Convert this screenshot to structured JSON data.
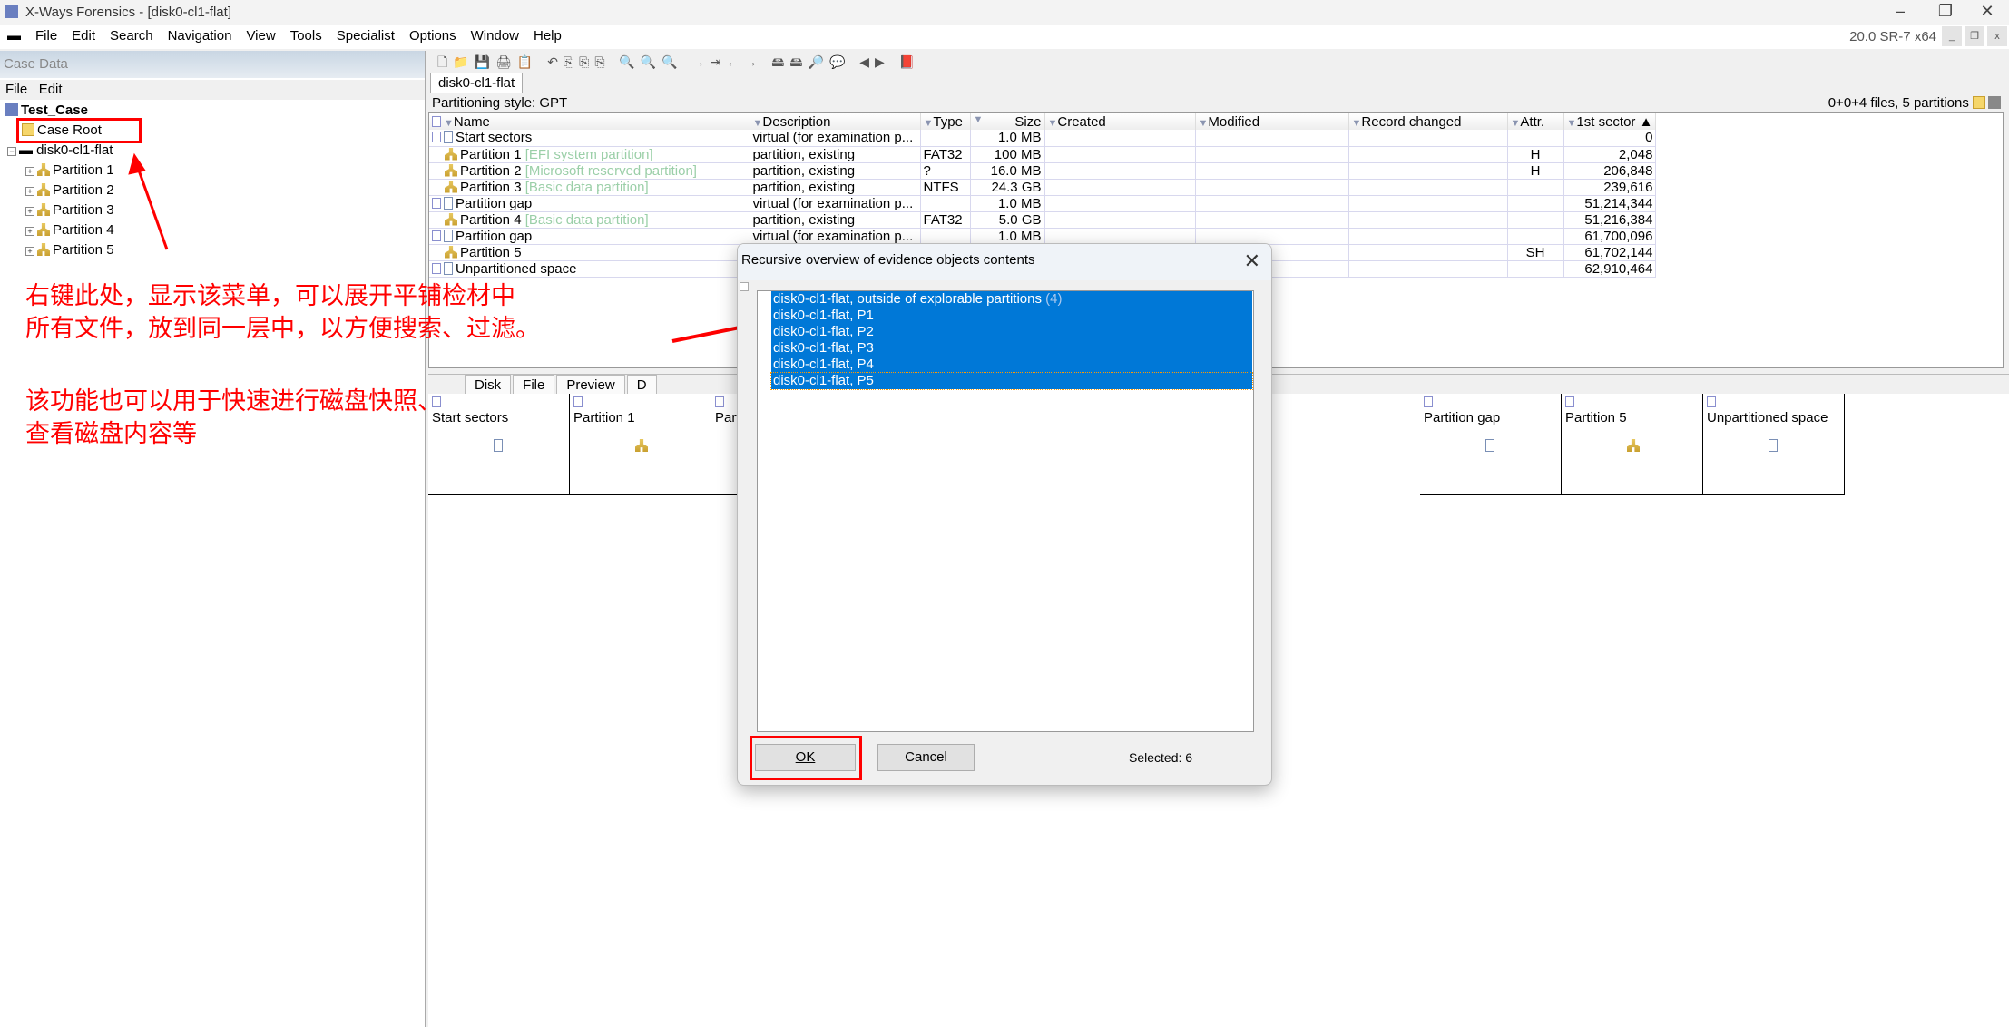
{
  "window": {
    "title": "X-Ways Forensics - [disk0-cl1-flat]",
    "version": "20.0 SR-7 x64"
  },
  "menu": [
    "File",
    "Edit",
    "Search",
    "Navigation",
    "View",
    "Tools",
    "Specialist",
    "Options",
    "Window",
    "Help"
  ],
  "case_panel": {
    "header": "Case Data",
    "menu": [
      "File",
      "Edit"
    ],
    "case_name": "Test_Case",
    "case_root": "Case Root",
    "evidence": "disk0-cl1-flat",
    "partitions": [
      "Partition 1",
      "Partition 2",
      "Partition 3",
      "Partition 4",
      "Partition 5"
    ]
  },
  "tab": "disk0-cl1-flat",
  "partitioning_style": "Partitioning style: GPT",
  "counts": "0+0+4 files, 5 partitions",
  "columns": [
    "Name",
    "Description",
    "Type",
    "Size",
    "Created",
    "Modified",
    "Record changed",
    "Attr.",
    "1st sector"
  ],
  "rows": [
    {
      "name": "Start sectors",
      "note": "",
      "desc": "virtual (for examination p...",
      "type": "",
      "size": "1.0 MB",
      "attr": "",
      "sector": "0",
      "icon": "file"
    },
    {
      "name": "Partition 1",
      "note": "[EFI system partition]",
      "desc": "partition, existing",
      "type": "FAT32",
      "size": "100 MB",
      "attr": "H",
      "sector": "2,048",
      "icon": "partition"
    },
    {
      "name": "Partition 2",
      "note": "[Microsoft reserved partition]",
      "desc": "partition, existing",
      "type": "?",
      "size": "16.0 MB",
      "attr": "H",
      "sector": "206,848",
      "icon": "partition"
    },
    {
      "name": "Partition 3",
      "note": "[Basic data partition]",
      "desc": "partition, existing",
      "type": "NTFS",
      "size": "24.3 GB",
      "attr": "",
      "sector": "239,616",
      "icon": "partition"
    },
    {
      "name": "Partition gap",
      "note": "",
      "desc": "virtual (for examination p...",
      "type": "",
      "size": "1.0 MB",
      "attr": "",
      "sector": "51,214,344",
      "icon": "file"
    },
    {
      "name": "Partition 4",
      "note": "[Basic data partition]",
      "desc": "partition, existing",
      "type": "FAT32",
      "size": "5.0 GB",
      "attr": "",
      "sector": "51,216,384",
      "icon": "partition"
    },
    {
      "name": "Partition gap",
      "note": "",
      "desc": "virtual (for examination p...",
      "type": "",
      "size": "1.0 MB",
      "attr": "",
      "sector": "61,700,096",
      "icon": "file"
    },
    {
      "name": "Partition 5",
      "note": "",
      "desc": "",
      "type": "",
      "size": "",
      "attr": "SH",
      "sector": "61,702,144",
      "icon": "partition"
    },
    {
      "name": "Unpartitioned space",
      "note": "",
      "desc": "",
      "type": "",
      "size": "",
      "attr": "",
      "sector": "62,910,464",
      "icon": "file"
    }
  ],
  "lower_tabs": [
    "Disk",
    "File",
    "Preview",
    "D"
  ],
  "gallery": [
    {
      "label": "Start sectors",
      "icon": "file"
    },
    {
      "label": "Partition 1",
      "icon": "partition"
    },
    {
      "label": "Part",
      "icon": "partition"
    },
    {
      "label": "Partition gap",
      "icon": "file"
    },
    {
      "label": "Partition 5",
      "icon": "partition"
    },
    {
      "label": "Unpartitioned space",
      "icon": "file"
    }
  ],
  "annotations": [
    "右键此处，显示该菜单，可以展开平铺检材中",
    "所有文件，放到同一层中，以方便搜索、过滤。",
    "该功能也可以用于快速进行磁盘快照、",
    "查看磁盘内容等"
  ],
  "dialog": {
    "title": "Recursive overview of evidence objects contents",
    "items": [
      {
        "label": "disk0-cl1-flat, outside of explorable partitions",
        "count": "(4)"
      },
      {
        "label": "disk0-cl1-flat, P1"
      },
      {
        "label": "disk0-cl1-flat, P2"
      },
      {
        "label": "disk0-cl1-flat, P3"
      },
      {
        "label": "disk0-cl1-flat, P4"
      },
      {
        "label": "disk0-cl1-flat, P5"
      }
    ],
    "ok": "OK",
    "cancel": "Cancel",
    "selected": "Selected: 6"
  },
  "colors": {
    "selection": "#0078d7",
    "annotation": "#ff0000"
  }
}
